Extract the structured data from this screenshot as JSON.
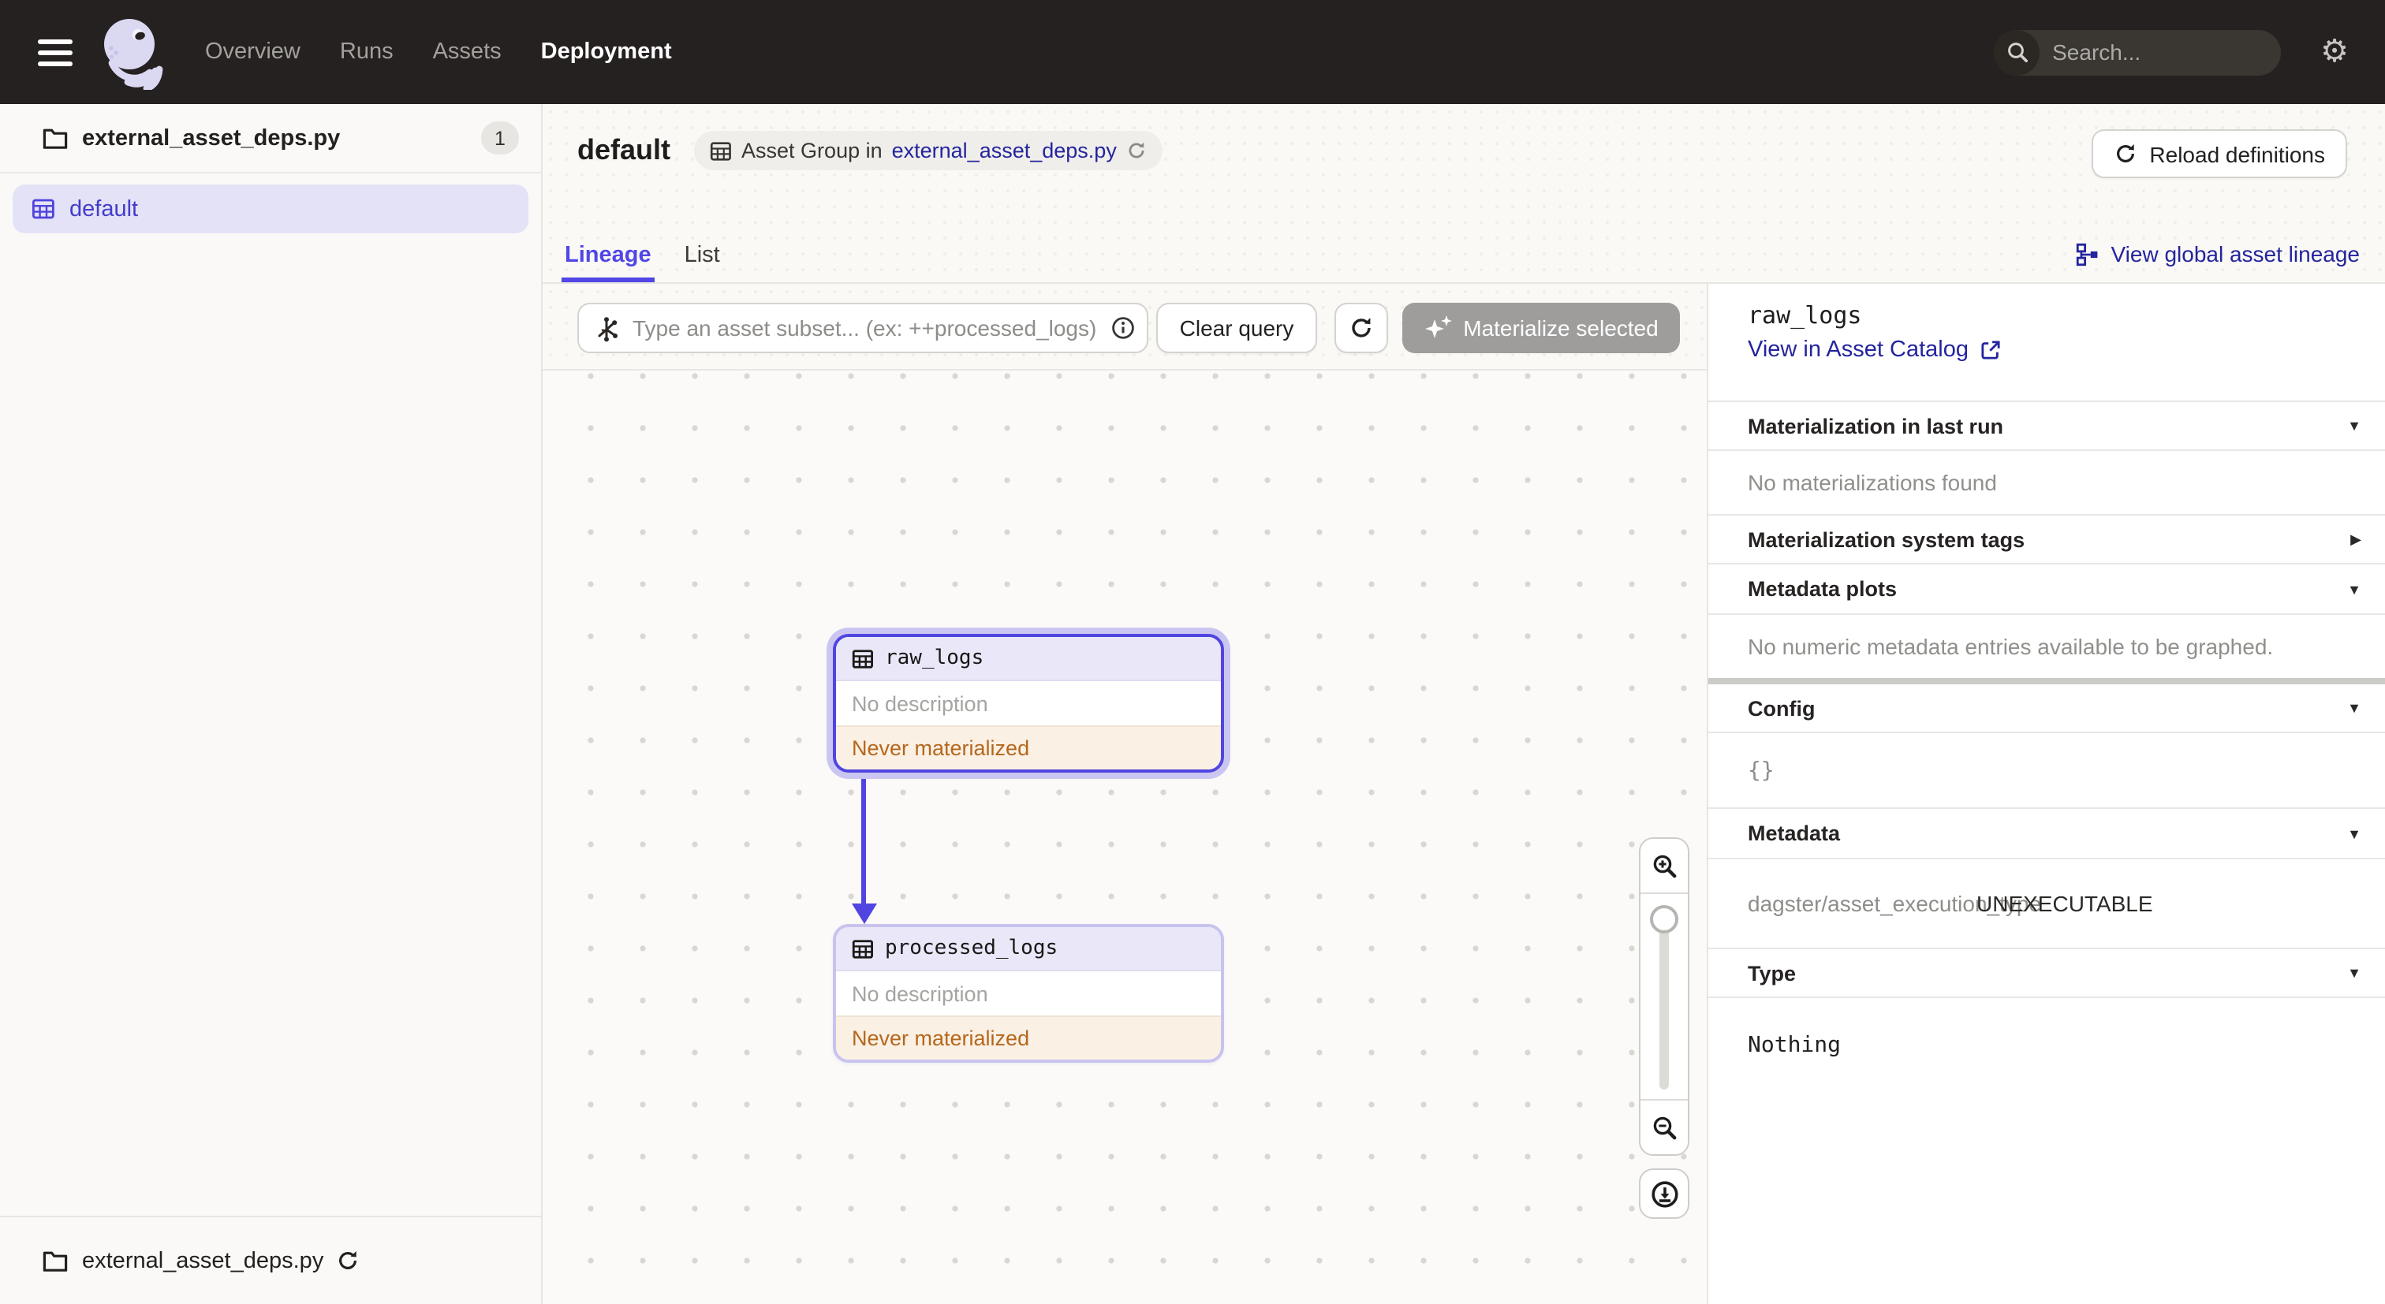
{
  "topbar": {
    "nav": [
      {
        "label": "Overview"
      },
      {
        "label": "Runs"
      },
      {
        "label": "Assets"
      },
      {
        "label": "Deployment"
      }
    ],
    "search_placeholder": "Search...",
    "search_shortcut": "/"
  },
  "sidebar": {
    "file_label": "external_asset_deps.py",
    "file_count": "1",
    "group_item": "default",
    "footer_label": "external_asset_deps.py"
  },
  "header": {
    "title": "default",
    "breadcrumb_prefix": "Asset Group in",
    "breadcrumb_link": "external_asset_deps.py",
    "reload_button": "Reload definitions"
  },
  "tabs": {
    "lineage": "Lineage",
    "list": "List",
    "global_link": "View global asset lineage"
  },
  "toolbar": {
    "query_placeholder": "Type an asset subset... (ex: ++processed_logs)",
    "clear_button": "Clear query",
    "materialize_button": "Materialize selected"
  },
  "graph": {
    "nodes": [
      {
        "name": "raw_logs",
        "description": "No description",
        "status": "Never materialized",
        "selected": true
      },
      {
        "name": "processed_logs",
        "description": "No description",
        "status": "Never materialized",
        "selected": false
      }
    ]
  },
  "panel": {
    "title": "raw_logs",
    "catalog_link": "View in Asset Catalog",
    "sections": {
      "last_run": {
        "label": "Materialization in last run",
        "empty": "No materializations found"
      },
      "system_tags": {
        "label": "Materialization system tags"
      },
      "metadata_plots": {
        "label": "Metadata plots",
        "empty": "No numeric metadata entries available to be graphed."
      },
      "config": {
        "label": "Config",
        "value": "{}"
      },
      "metadata": {
        "label": "Metadata",
        "key": "dagster/asset_execution_type",
        "value": "UNEXECUTABLE"
      },
      "type": {
        "label": "Type",
        "value": "Nothing"
      }
    }
  },
  "colors": {
    "accent": "#5146E6",
    "link": "#24249E",
    "status_text": "#B5671D",
    "status_bg": "#FAF0E4",
    "topbar_bg": "#252120"
  }
}
